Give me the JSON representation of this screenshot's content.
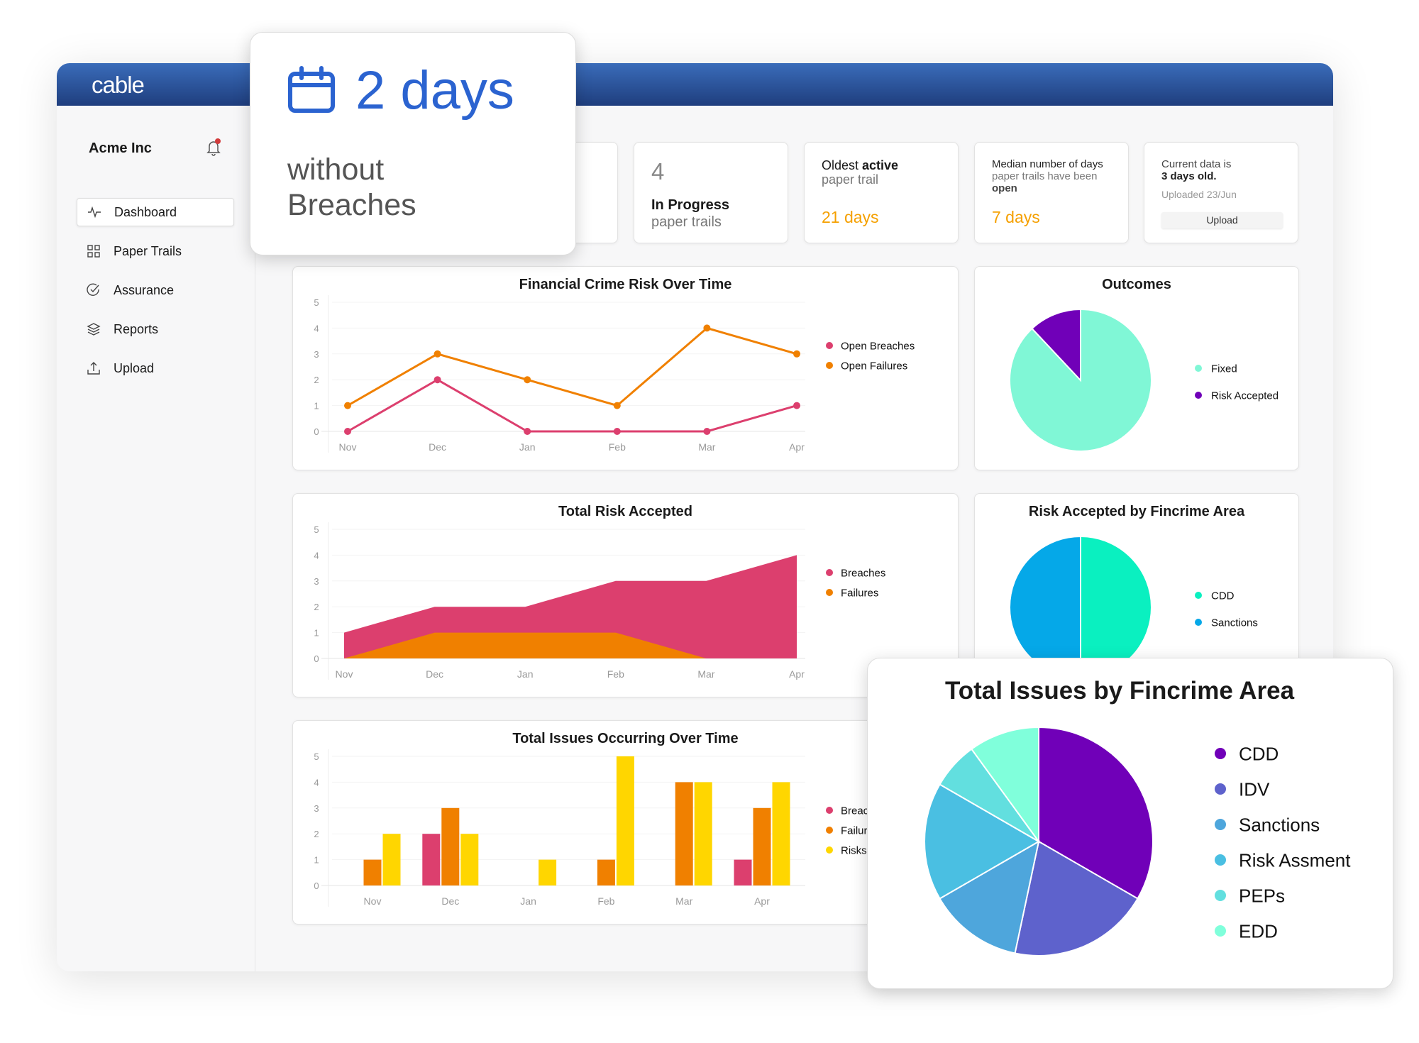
{
  "app": {
    "logo": "cable",
    "org": "Acme Inc"
  },
  "sidebar": {
    "items": [
      {
        "label": "Dashboard",
        "icon": "activity-icon",
        "active": true
      },
      {
        "label": "Paper Trails",
        "icon": "grid-icon"
      },
      {
        "label": "Assurance",
        "icon": "check-circle-icon"
      },
      {
        "label": "Reports",
        "icon": "layers-icon"
      },
      {
        "label": "Upload",
        "icon": "upload-icon"
      }
    ]
  },
  "highlight": {
    "value": "2 days",
    "line1": "without",
    "line2": "Breaches",
    "color": "#2b63d0"
  },
  "stats": {
    "in_progress": {
      "value": "4",
      "bold": "In Progress",
      "sub": "paper trails"
    },
    "oldest": {
      "pre": "Oldest ",
      "bold": "active",
      "sub": "paper trail",
      "value": "21 days"
    },
    "median": {
      "line1": "Median number of days",
      "line2": "paper trails have been",
      "bold": "open",
      "value": "7 days"
    },
    "current": {
      "line1": "Current data is",
      "bold": "3 days old.",
      "uploaded": "Uploaded 23/Jun",
      "button": "Upload"
    }
  },
  "colors": {
    "breaches": "#dc3f6e",
    "failures": "#f08000",
    "risks": "#ffd600",
    "accent": "#f5a000"
  },
  "chart_data": [
    {
      "type": "line",
      "title": "Financial Crime Risk Over Time",
      "categories": [
        "Nov",
        "Dec",
        "Jan",
        "Feb",
        "Mar",
        "Apr"
      ],
      "ylim": [
        0,
        5
      ],
      "yticks": [
        "0",
        "1",
        "2",
        "3",
        "4",
        "5"
      ],
      "grid": true,
      "legend": "right",
      "series": [
        {
          "name": "Open Breaches",
          "color": "#dc3f6e",
          "values": [
            0,
            2,
            0,
            0,
            0,
            1
          ]
        },
        {
          "name": "Open Failures",
          "color": "#f08000",
          "values": [
            1,
            3,
            2,
            1,
            4,
            3
          ]
        }
      ]
    },
    {
      "type": "pie",
      "title": "Outcomes",
      "legend": "right",
      "slices": [
        {
          "name": "Fixed",
          "value": 88,
          "color": "#80f7d6"
        },
        {
          "name": "Risk Accepted",
          "value": 12,
          "color": "#7000b8"
        }
      ]
    },
    {
      "type": "area",
      "title": "Total Risk Accepted",
      "categories": [
        "Nov",
        "Dec",
        "Jan",
        "Feb",
        "Mar",
        "Apr"
      ],
      "ylim": [
        0,
        5
      ],
      "yticks": [
        "0",
        "1",
        "2",
        "3",
        "4",
        "5"
      ],
      "grid": true,
      "legend": "right",
      "series": [
        {
          "name": "Breaches",
          "color": "#dc3f6e",
          "values": [
            1,
            2,
            2,
            3,
            3,
            4
          ]
        },
        {
          "name": "Failures",
          "color": "#f08000",
          "values": [
            0,
            1,
            1,
            1,
            0,
            0
          ]
        }
      ]
    },
    {
      "type": "pie",
      "title": "Risk Accepted by Fincrime Area",
      "legend": "right",
      "slices": [
        {
          "name": "CDD",
          "value": 50,
          "color": "#0af0c0"
        },
        {
          "name": "Sanctions",
          "value": 50,
          "color": "#05a8e8"
        }
      ]
    },
    {
      "type": "bar",
      "title": "Total Issues Occurring Over Time",
      "categories": [
        "Nov",
        "Dec",
        "Jan",
        "Feb",
        "Mar",
        "Apr"
      ],
      "ylim": [
        0,
        5
      ],
      "yticks": [
        "0",
        "1",
        "2",
        "3",
        "4",
        "5"
      ],
      "grid": true,
      "legend": "right",
      "series": [
        {
          "name": "Breaches",
          "color": "#dc3f6e",
          "values": [
            0,
            2,
            0,
            0,
            0,
            1
          ]
        },
        {
          "name": "Failures",
          "color": "#f08000",
          "values": [
            1,
            3,
            0,
            1,
            4,
            3
          ]
        },
        {
          "name": "Risks",
          "color": "#ffd600",
          "values": [
            2,
            2,
            1,
            5,
            4,
            4
          ]
        }
      ]
    },
    {
      "type": "pie",
      "title": "Total Issues by Fincrime Area",
      "legend": "right",
      "slices": [
        {
          "name": "CDD",
          "value": 10,
          "color": "#7000b8"
        },
        {
          "name": "IDV",
          "value": 6,
          "color": "#5e62cc"
        },
        {
          "name": "Sanctions",
          "value": 4,
          "color": "#4ea6dc"
        },
        {
          "name": "Risk Assment",
          "value": 5,
          "color": "#4abfe2"
        },
        {
          "name": "PEPs",
          "value": 2,
          "color": "#62dfdf"
        },
        {
          "name": "EDD",
          "value": 3,
          "color": "#80ffdb"
        }
      ]
    }
  ]
}
